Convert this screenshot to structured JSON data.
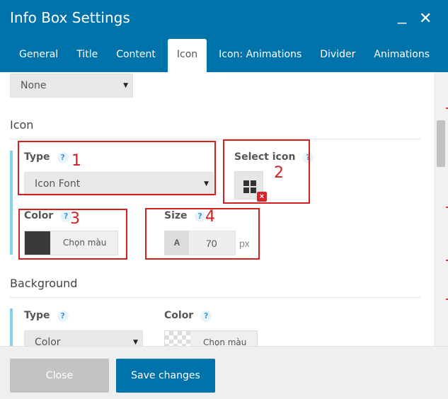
{
  "header": {
    "title": "Info Box Settings",
    "minimize_label": "_",
    "close_label": "✕",
    "tabs": [
      "General",
      "Title",
      "Content",
      "Icon",
      "Icon: Animations",
      "Divider",
      "Animations"
    ],
    "active_tab": "Icon"
  },
  "top_select": {
    "value": "None"
  },
  "icon_section": {
    "title": "Icon",
    "type": {
      "label": "Type",
      "value": "Icon Font"
    },
    "select_icon": {
      "label": "Select icon"
    },
    "color": {
      "label": "Color",
      "picker_text": "Chọn màu",
      "swatch": "#393939"
    },
    "size": {
      "label": "Size",
      "prefix": "A",
      "value": "70",
      "unit": "px"
    },
    "help_glyph": "?"
  },
  "annotations": [
    "1",
    "2",
    "3",
    "4"
  ],
  "background_section": {
    "title": "Background",
    "type": {
      "label": "Type",
      "value": "Color"
    },
    "color": {
      "label": "Color",
      "picker_text": "Chọn màu"
    }
  },
  "footer": {
    "close_label": "Close",
    "save_label": "Save changes"
  },
  "colors": {
    "brand": "#0073aa",
    "accent": "#7fd3e6",
    "annotation": "#d21f1f"
  }
}
